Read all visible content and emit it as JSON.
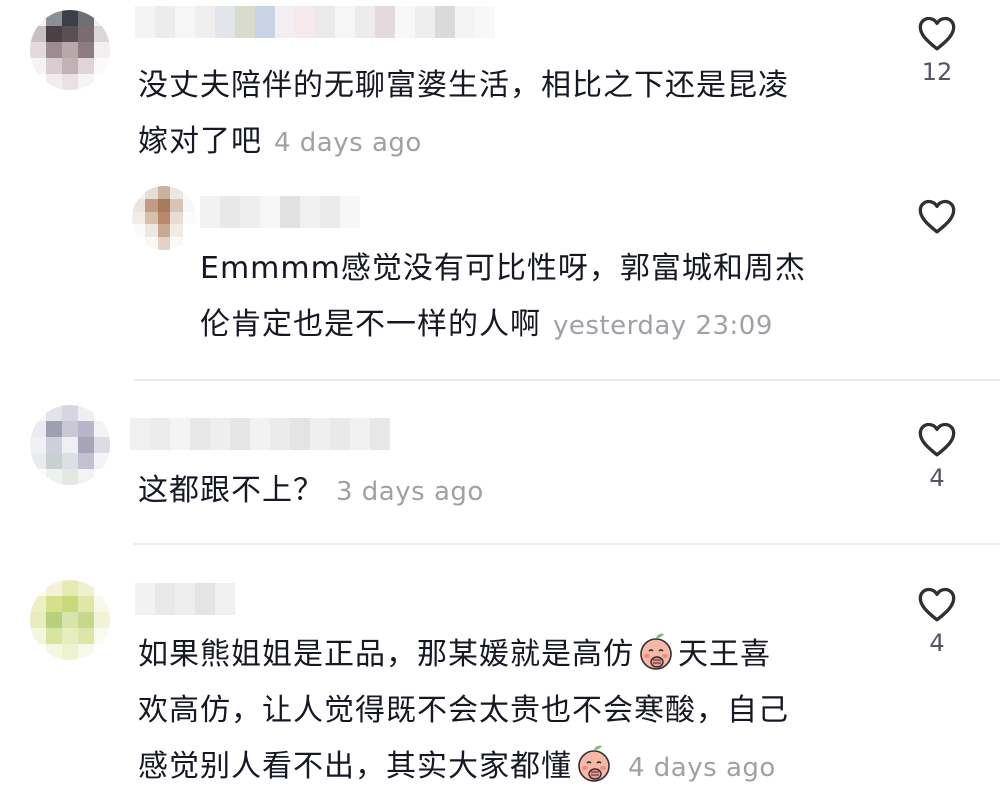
{
  "colors": {
    "text": "#161823",
    "timestamp": "#a0a0a6",
    "divider": "#ececec",
    "like_icon": "#2f2f35"
  },
  "comments": [
    {
      "text": "没丈夫陪伴的无聊富婆生活，相比之下还是昆凌嫁对了吧",
      "line1": "没丈夫陪伴的无聊富婆生活，相比之下还是昆凌",
      "line2": "嫁对了吧",
      "timestamp": "4 days ago",
      "likes": "12",
      "icon": "heart-outline-icon",
      "avatar_pixels": [
        "#f2f2f3",
        "#8c8f95",
        "#3b3f46",
        "#6c6f75",
        "#eef0f2",
        "#c9c0c2",
        "#4a4145",
        "#5b4f53",
        "#7a6c70",
        "#dcd6d8",
        "#e4dadd",
        "#9e8c91",
        "#b9a7ab",
        "#8d7c80",
        "#f3eef0",
        "#f6f3f4",
        "#d8cdd0",
        "#c2b2b6",
        "#e0d6d9",
        "#fafafa",
        "#ffffff",
        "#f1ecee",
        "#e9e2e5",
        "#f7f4f5",
        "#ffffff"
      ],
      "username_pixels": [
        "#f4f4f4",
        "#ececec",
        "#f6f6f6",
        "#f0eeee",
        "#e2e6ec",
        "#d9dccd",
        "#c8d3e6",
        "#f3eef2",
        "#f7e8ec",
        "#eaeaea",
        "#f6f6f6",
        "#ececec",
        "#e4d9dc",
        "#f8f8f8",
        "#eeeeee",
        "#dadada",
        "#f4f4f4",
        "#f8f8f8"
      ],
      "reply": {
        "text": "Emmmm感觉没有可比性呀，郭富城和周杰伦肯定也是不一样的人啊",
        "line1": "Emmmm感觉没有可比性呀，郭富城和周杰",
        "line2": "伦肯定也是不一样的人啊",
        "timestamp": "yesterday 23:09",
        "icon": "heart-outline-icon",
        "avatar_pixels": [
          "#f4f4f4",
          "#e6ddd7",
          "#c9b09f",
          "#efe6e0",
          "#fafafa",
          "#ece4de",
          "#c29d84",
          "#a87b5c",
          "#d9c5b8",
          "#f7f7f7",
          "#f2ece8",
          "#d7bfae",
          "#b8896a",
          "#e8ddd5",
          "#fbfbfb",
          "#fafafa",
          "#efe7e2",
          "#caa993",
          "#f1ebe7",
          "#ffffff",
          "#ffffff",
          "#faf7f5",
          "#e2d2c6",
          "#fbf8f6",
          "#ffffff"
        ],
        "username_pixels": [
          "#f2f2f2",
          "#e8e8e8",
          "#eeeeee",
          "#f6f6f6",
          "#e2e2e2",
          "#f0f0f0",
          "#ebebeb",
          "#f7f7f7"
        ]
      }
    },
    {
      "text": "这都跟不上？",
      "timestamp": "3 days ago",
      "likes": "4",
      "icon": "heart-outline-icon",
      "avatar_pixels": [
        "#f7f7f9",
        "#e3e3ea",
        "#d6d6e0",
        "#eeeef3",
        "#ffffff",
        "#ebebf1",
        "#9d9fb3",
        "#c9c9d6",
        "#b9b4c8",
        "#f3f3f7",
        "#f1f1f5",
        "#cfcfdb",
        "#efeff4",
        "#a7a4b9",
        "#dcdce6",
        "#e8ecec",
        "#c9d0d0",
        "#dcdfe6",
        "#c4c0d1",
        "#f4f4f8",
        "#fcfcfd",
        "#eef2ee",
        "#e3e8e3",
        "#f3f3f6",
        "#ffffff"
      ],
      "username_pixels": [
        "#f0f0f0",
        "#ececec",
        "#f4f4f4",
        "#e8e8e8",
        "#eeeeee",
        "#e6e6e6",
        "#f2f2f2",
        "#ebebeb",
        "#e4e4e4",
        "#efefef",
        "#e9e9e9",
        "#f1f1f1",
        "#e7e7e7"
      ]
    },
    {
      "text": "如果熊姐姐是正品，那某媛就是高仿🤭天王喜欢高仿，让人觉得既不会太贵也不会寒酸，自己感觉别人看不出，其实大家都懂🤭",
      "line1": "如果熊姐姐是正品，那某媛就是高仿",
      "line1_after": "天王喜",
      "line2": "欢高仿，让人觉得既不会太贵也不会寒酸，自己",
      "line3": "感觉别人看不出，其实大家都懂",
      "timestamp": "4 days ago",
      "likes": "4",
      "icon": "heart-outline-icon",
      "emoji_icon": "peach-face-covering-mouth-icon",
      "avatar_pixels": [
        "#fbfbf6",
        "#f2f3d9",
        "#e6ebb4",
        "#eef0cf",
        "#ffffff",
        "#eef0c4",
        "#d5e08b",
        "#c8d87a",
        "#dfe7a6",
        "#f7f8ea",
        "#e9edbd",
        "#b8cf7c",
        "#d9e4ac",
        "#c5d98d",
        "#f1f3d6",
        "#f4f5dd",
        "#d8e5a0",
        "#e6edbe",
        "#dbe6a8",
        "#fafaf0",
        "#ffffff",
        "#f5f7e2",
        "#eef2cd",
        "#f7f8e8",
        "#ffffff"
      ],
      "username_pixels": [
        "#f2f2f2",
        "#e9e9e9",
        "#eeeeee",
        "#e4e4e4",
        "#f0f0f0"
      ]
    }
  ]
}
